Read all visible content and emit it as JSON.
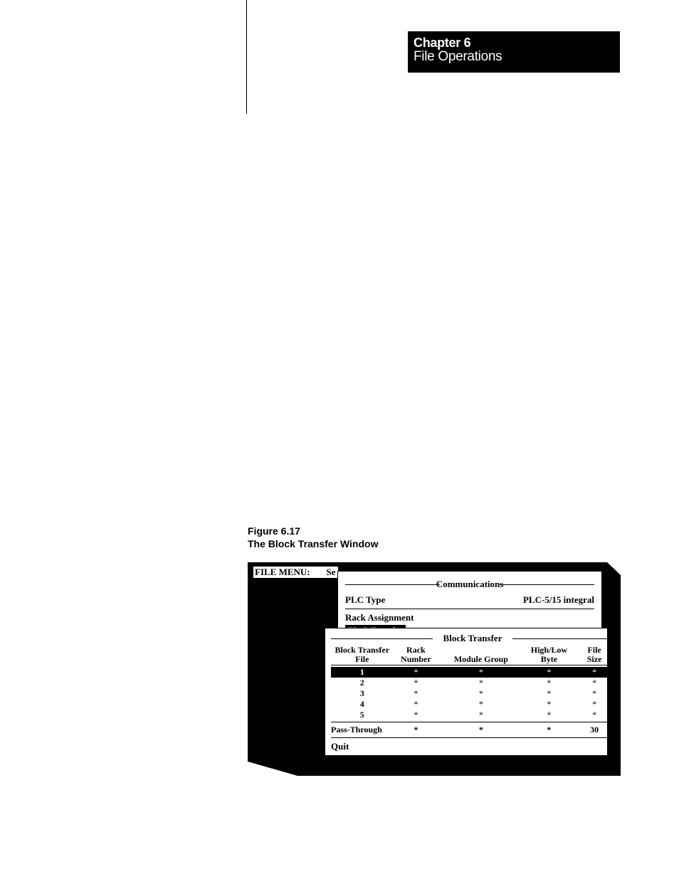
{
  "header": {
    "chapter": "Chapter 6",
    "title": "File Operations"
  },
  "figure": {
    "number": "Figure 6.17",
    "title": "The Block Transfer Window"
  },
  "window": {
    "file_menu_label": "FILE MENU:",
    "file_menu_rest": "Se",
    "comm": {
      "group_title": "Communications",
      "plc_type_label": "PLC Type",
      "plc_type_value": "PLC-5/15 integral",
      "rack_assignment_label": "Rack Assignment",
      "selected_item": "Block Transfer"
    },
    "bt": {
      "group_title": "Block Transfer",
      "headers": {
        "col1a": "Block Transfer",
        "col1b": "File",
        "col2a": "Rack",
        "col2b": "Number",
        "col3": "Module Group",
        "col4a": "High/Low",
        "col4b": "Byte",
        "col5a": "File",
        "col5b": "Size"
      },
      "rows": [
        {
          "file": "1",
          "rack": "*",
          "mg": "*",
          "hl": "*",
          "size": "*",
          "selected": true
        },
        {
          "file": "2",
          "rack": "*",
          "mg": "*",
          "hl": "*",
          "size": "*",
          "selected": false
        },
        {
          "file": "3",
          "rack": "*",
          "mg": "*",
          "hl": "*",
          "size": "*",
          "selected": false
        },
        {
          "file": "4",
          "rack": "*",
          "mg": "*",
          "hl": "*",
          "size": "*",
          "selected": false
        },
        {
          "file": "5",
          "rack": "*",
          "mg": "*",
          "hl": "*",
          "size": "*",
          "selected": false
        }
      ],
      "pass": {
        "label": "Pass-Through",
        "rack": "*",
        "mg": "*",
        "hl": "*",
        "size": "30"
      },
      "quit": "Quit"
    }
  }
}
